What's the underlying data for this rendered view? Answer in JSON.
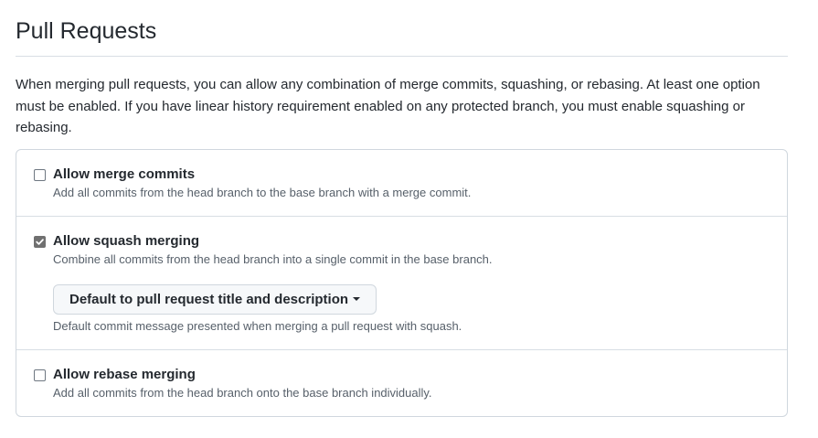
{
  "section": {
    "title": "Pull Requests",
    "description": "When merging pull requests, you can allow any combination of merge commits, squashing, or rebasing. At least one option must be enabled. If you have linear history requirement enabled on any protected branch, you must enable squashing or rebasing."
  },
  "options": [
    {
      "label": "Allow merge commits",
      "description": "Add all commits from the head branch to the base branch with a merge commit.",
      "checked": false
    },
    {
      "label": "Allow squash merging",
      "description": "Combine all commits from the head branch into a single commit in the base branch.",
      "checked": true,
      "dropdown": {
        "label": "Default to pull request title and description",
        "icon": "caret-down-icon"
      },
      "note": "Default commit message presented when merging a pull request with squash."
    },
    {
      "label": "Allow rebase merging",
      "description": "Add all commits from the head branch onto the base branch individually.",
      "checked": false
    }
  ],
  "colors": {
    "text": "#24292f",
    "muted": "#57606a",
    "border": "#d0d7de",
    "checked_fill": "#707070",
    "button_bg": "#f6f8fa"
  }
}
